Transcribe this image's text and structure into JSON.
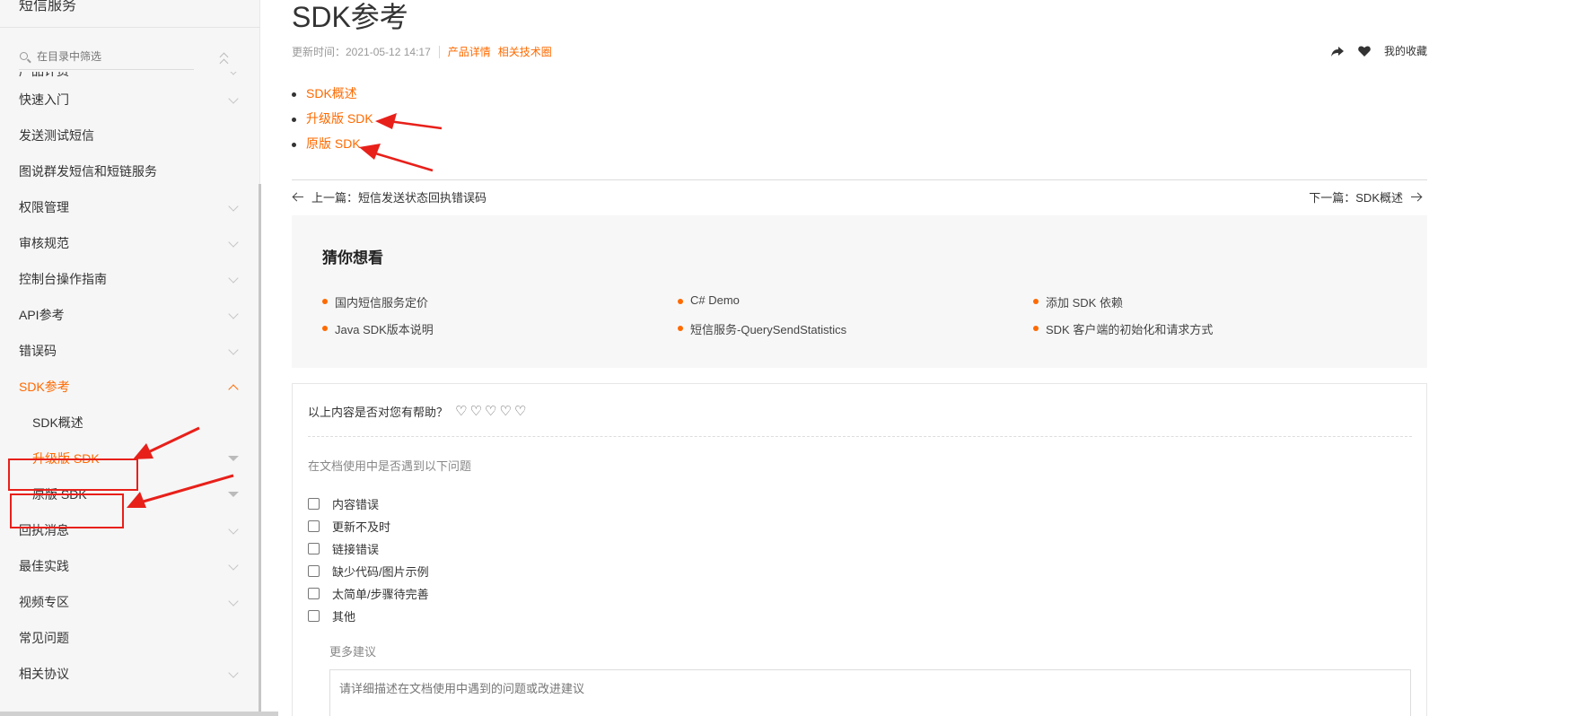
{
  "sidebar": {
    "title": "短信服务",
    "search_placeholder": "在目录中筛选",
    "partial_item": "产品计费",
    "items": [
      {
        "label": "快速入门"
      },
      {
        "label": "发送测试短信"
      },
      {
        "label": "图说群发短信和短链服务"
      },
      {
        "label": "权限管理"
      },
      {
        "label": "审核规范"
      },
      {
        "label": "控制台操作指南"
      },
      {
        "label": "API参考"
      },
      {
        "label": "错误码"
      },
      {
        "label": "SDK参考"
      },
      {
        "label": "SDK概述"
      },
      {
        "label": "升级版 SDK"
      },
      {
        "label": "原版 SDK"
      },
      {
        "label": "回执消息"
      },
      {
        "label": "最佳实践"
      },
      {
        "label": "视频专区"
      },
      {
        "label": "常见问题"
      },
      {
        "label": "相关协议"
      }
    ]
  },
  "main": {
    "title": "SDK参考",
    "updated": "更新时间：2021-05-12 14:17",
    "links": [
      "产品详情",
      "相关技术圈"
    ],
    "favorite_label": "我的收藏",
    "toc": [
      "SDK概述",
      "升级版 SDK",
      "原版 SDK"
    ],
    "prev": "上一篇：短信发送状态回执错误码",
    "next": "下一篇：SDK概述"
  },
  "guess": {
    "title": "猜你想看",
    "items": [
      "国内短信服务定价",
      "C# Demo",
      "添加 SDK 依赖",
      "Java SDK版本说明",
      "短信服务-QuerySendStatistics",
      "SDK 客户端的初始化和请求方式"
    ]
  },
  "feedback": {
    "question": "以上内容是否对您有帮助？",
    "rating_icon": "♡",
    "subtitle": "在文档使用中是否遇到以下问题",
    "options": [
      "内容错误",
      "更新不及时",
      "链接错误",
      "缺少代码/图片示例",
      "太简单/步骤待完善",
      "其他"
    ],
    "more_label": "更多建议",
    "textarea_placeholder": "请详细描述在文档使用中遇到的问题或改进建议"
  },
  "colors": {
    "accent": "#ff6a00",
    "annotation": "#e8201a"
  }
}
